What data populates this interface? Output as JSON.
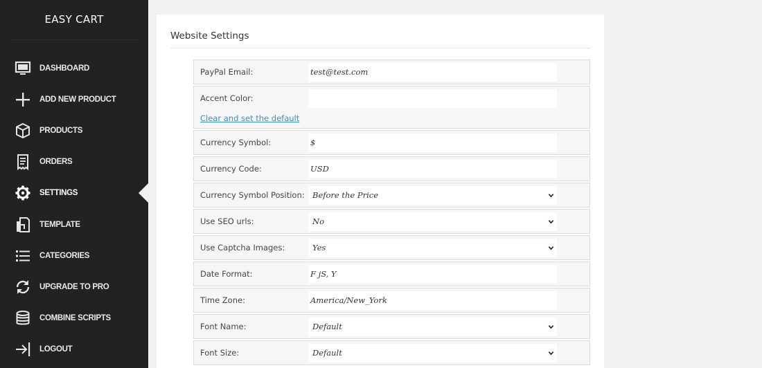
{
  "brand": {
    "title": "EASY CART"
  },
  "sidebar": {
    "items": [
      {
        "label": "DASHBOARD",
        "icon": "monitor-icon"
      },
      {
        "label": "ADD NEW PRODUCT",
        "icon": "plus-icon"
      },
      {
        "label": "PRODUCTS",
        "icon": "box-icon"
      },
      {
        "label": "ORDERS",
        "icon": "receipt-icon"
      },
      {
        "label": "SETTINGS",
        "icon": "gear-icon",
        "active": true
      },
      {
        "label": "TEMPLATE",
        "icon": "document-icon"
      },
      {
        "label": "CATEGORIES",
        "icon": "list-icon"
      },
      {
        "label": "UPGRADE TO PRO",
        "icon": "refresh-icon"
      },
      {
        "label": "COMBINE SCRIPTS",
        "icon": "database-icon"
      },
      {
        "label": "LOGOUT",
        "icon": "logout-icon"
      }
    ]
  },
  "main": {
    "title": "Website Settings",
    "fields": {
      "paypal_email": {
        "label": "PayPal Email:",
        "value": "test@test.com"
      },
      "accent_color": {
        "label": "Accent Color:",
        "value": "",
        "link": "Clear and set the default"
      },
      "currency_symbol": {
        "label": "Currency Symbol:",
        "value": "$"
      },
      "currency_code": {
        "label": "Currency Code:",
        "value": "USD"
      },
      "currency_symbol_position": {
        "label": "Currency Symbol Position:",
        "value": "Before the Price"
      },
      "use_seo_urls": {
        "label": "Use SEO urls:",
        "value": "No"
      },
      "use_captcha_images": {
        "label": "Use Captcha Images:",
        "value": "Yes"
      },
      "date_format": {
        "label": "Date Format:",
        "value": "F jS, Y"
      },
      "time_zone": {
        "label": "Time Zone:",
        "value": "America/New_York"
      },
      "font_name": {
        "label": "Font Name:",
        "value": "Default"
      },
      "font_size": {
        "label": "Font Size:",
        "value": "Default"
      }
    }
  },
  "colors": {
    "sidebar_bg": "#222222",
    "link": "#3b8fc4",
    "row_bg": "#f6f6f6"
  }
}
